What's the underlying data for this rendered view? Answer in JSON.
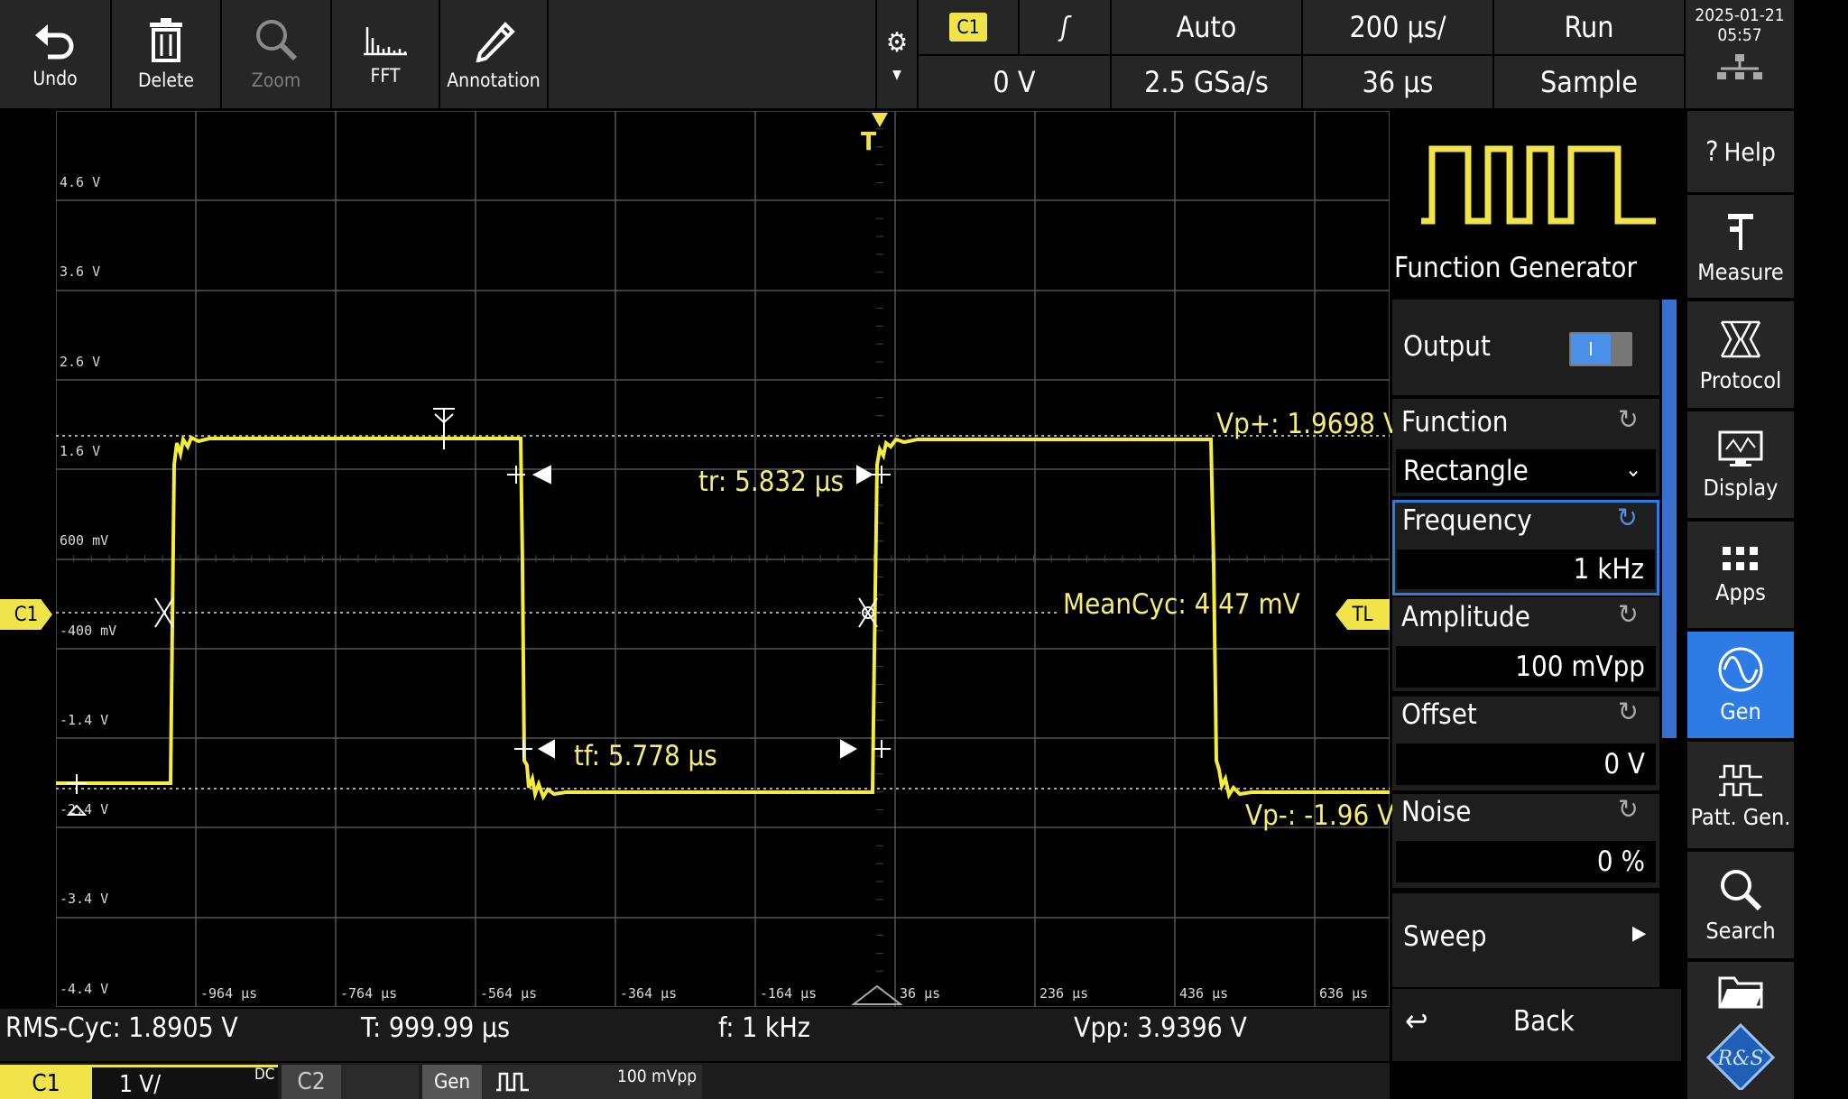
{
  "toolbar": {
    "undo": "Undo",
    "delete": "Delete",
    "zoom": "Zoom",
    "fft": "FFT",
    "annotation": "Annotation"
  },
  "header": {
    "channel": "C1",
    "slope_symbol": "ʃ",
    "trigger_mode": "Auto",
    "timebase": "200 µs/",
    "run_state": "Run",
    "trigger_level": "0 V",
    "sample_rate": "2.5 GSa/s",
    "position": "36 µs",
    "acq_mode": "Sample",
    "date": "2025-01-21",
    "time": "05:57"
  },
  "plot": {
    "y_ticks": [
      "4.6 V",
      "3.6 V",
      "2.6 V",
      "1.6 V",
      "600 mV",
      "-400 mV",
      "-1.4 V",
      "-2.4 V",
      "-3.4 V",
      "-4.4 V"
    ],
    "x_ticks": [
      "-964 µs",
      "-764 µs",
      "-564 µs",
      "-364 µs",
      "-164 µs",
      "36 µs",
      "236 µs",
      "436 µs",
      "636 µs"
    ],
    "trigger_marker": "T",
    "channel_marker": "C1",
    "trigger_level_marker": "TL",
    "annotations": {
      "vp_plus": "Vp+: 1.9698 V",
      "vp_minus": "Vp-: -1.96 V",
      "tr": "tr: 5.832 µs",
      "tf": "tf: 5.778 µs",
      "mean": "MeanCyc: 4.47 mV"
    },
    "trace_color": "#f5ec3c"
  },
  "panel": {
    "title": "Function Generator",
    "output_label": "Output",
    "function_label": "Function",
    "function_value": "Rectangle",
    "frequency_label": "Frequency",
    "frequency_value": "1 kHz",
    "amplitude_label": "Amplitude",
    "amplitude_value": "100 mVpp",
    "offset_label": "Offset",
    "offset_value": "0 V",
    "noise_label": "Noise",
    "noise_value": "0 %",
    "sweep_label": "Sweep",
    "back_label": "Back"
  },
  "side": {
    "help": "Help",
    "measure": "Measure",
    "protocol": "Protocol",
    "display": "Display",
    "apps": "Apps",
    "gen": "Gen",
    "patt_gen": "Patt. Gen.",
    "search": "Search",
    "logo": "R&S"
  },
  "measurements": {
    "rms": "RMS-Cyc: 1.8905 V",
    "period": "T: 999.99 µs",
    "freq": "f: 1 kHz",
    "vpp": "Vpp: 3.9396 V"
  },
  "bottom": {
    "c1": "C1",
    "c1_scale": "1 V/",
    "c1_coupling": "DC",
    "c2": "C2",
    "gen": "Gen",
    "gen_amp": "100 mVpp"
  },
  "colors": {
    "accent_blue": "#2d7ce6",
    "trace_yellow": "#f5ec3c"
  }
}
